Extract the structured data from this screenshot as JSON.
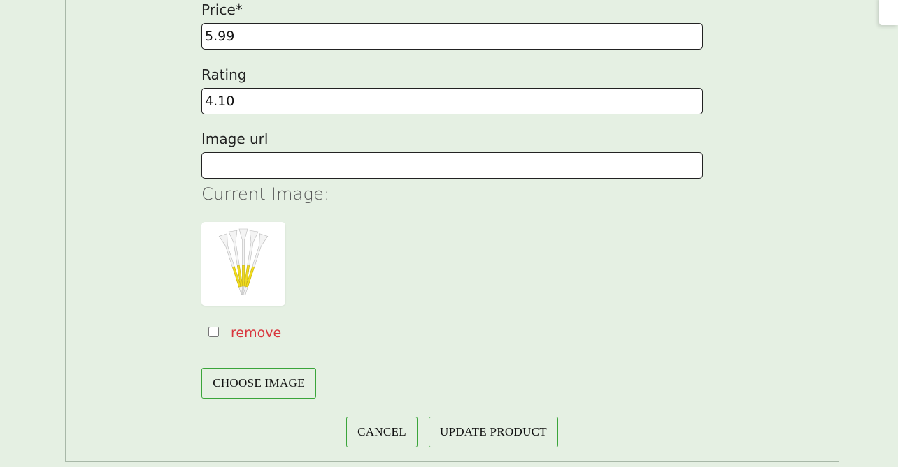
{
  "form": {
    "price": {
      "label": "Price*",
      "value": "5.99"
    },
    "rating": {
      "label": "Rating",
      "value": "4.10"
    },
    "image_url": {
      "label": "Image url",
      "value": ""
    },
    "current_image_label": "Current Image:",
    "remove_label": "remove",
    "choose_image_label": "CHOOSE IMAGE"
  },
  "actions": {
    "cancel_label": "CANCEL",
    "update_label": "UPDATE PRODUCT"
  },
  "colors": {
    "background": "#e5f0e3",
    "button_border": "#3aa53a",
    "remove_text": "#d9363e",
    "tee_yellow": "#f2dc1e"
  }
}
